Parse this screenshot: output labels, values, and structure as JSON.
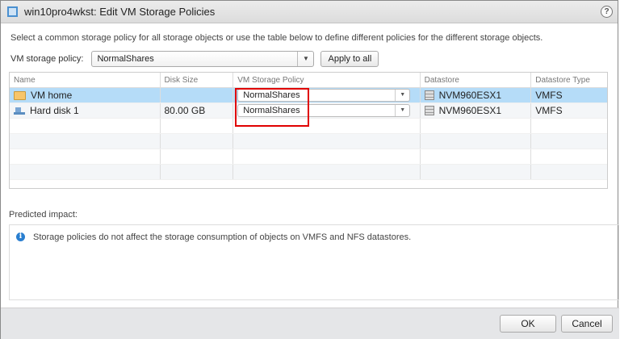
{
  "title": "win10pro4wkst: Edit VM Storage Policies",
  "help": "?",
  "intro": "Select a common storage policy for all storage objects or use the table below to define different policies for the different storage objects.",
  "policy": {
    "label": "VM storage policy:",
    "value": "NormalShares",
    "apply_label": "Apply to all"
  },
  "table": {
    "headers": [
      "Name",
      "Disk Size",
      "VM Storage Policy",
      "Datastore",
      "Datastore Type"
    ],
    "rows": [
      {
        "name": "VM home",
        "icon": "folder-icon",
        "size": "",
        "policy": "NormalShares",
        "datastore": "NVM960ESX1",
        "type": "VMFS"
      },
      {
        "name": "Hard disk 1",
        "icon": "hard-disk-icon",
        "size": "80.00 GB",
        "policy": "NormalShares",
        "datastore": "NVM960ESX1",
        "type": "VMFS"
      }
    ]
  },
  "impact": {
    "label": "Predicted impact:",
    "message": "Storage policies do not affect the storage consumption of objects on VMFS and NFS datastores."
  },
  "buttons": {
    "ok": "OK",
    "cancel": "Cancel"
  }
}
